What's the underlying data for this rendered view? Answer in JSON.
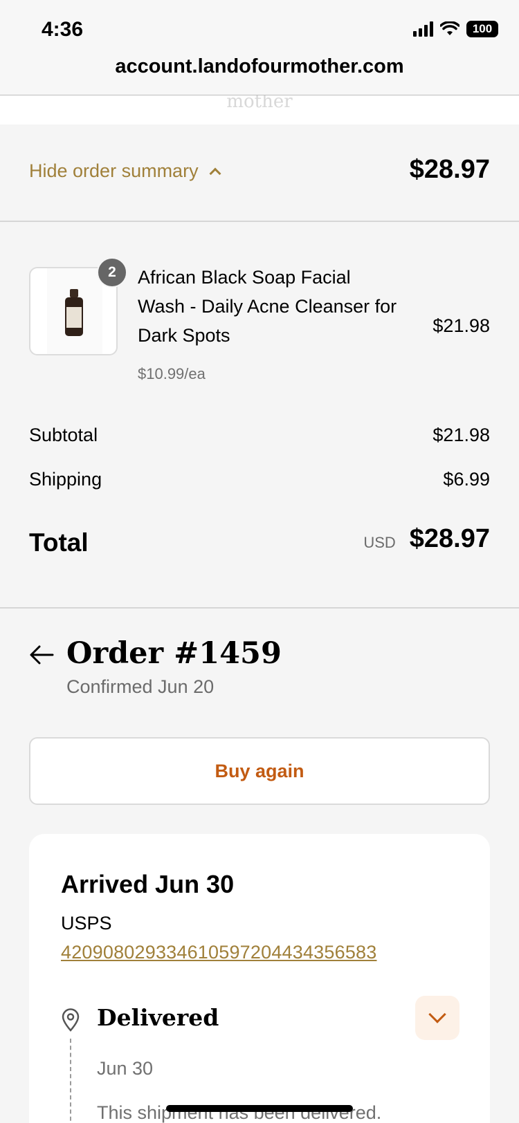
{
  "status_bar": {
    "time": "4:36",
    "battery": "100"
  },
  "browser": {
    "url": "account.landofourmother.com"
  },
  "header": {
    "logo_fragment": "mother"
  },
  "summary": {
    "toggle_label": "Hide order summary",
    "total": "$28.97"
  },
  "line_item": {
    "quantity": "2",
    "title": "African Black Soap Facial Wash - Daily Acne Cleanser for Dark Spots",
    "unit_price": "$10.99/ea",
    "price": "$21.98"
  },
  "costs": {
    "subtotal_label": "Subtotal",
    "subtotal_value": "$21.98",
    "shipping_label": "Shipping",
    "shipping_value": "$6.99",
    "total_label": "Total",
    "currency": "USD",
    "total_value": "$28.97"
  },
  "order": {
    "title": "Order #1459",
    "confirmed": "Confirmed Jun 20",
    "buy_again_label": "Buy again"
  },
  "shipment": {
    "status_heading": "Arrived Jun 30",
    "carrier": "USPS",
    "tracking_number": "420908029334610597204434356583",
    "event_title": "Delivered",
    "event_date": "Jun 30",
    "event_message": "This shipment has been delivered."
  },
  "colors": {
    "accent_gold": "#a0803a",
    "accent_orange": "#c25b12"
  }
}
